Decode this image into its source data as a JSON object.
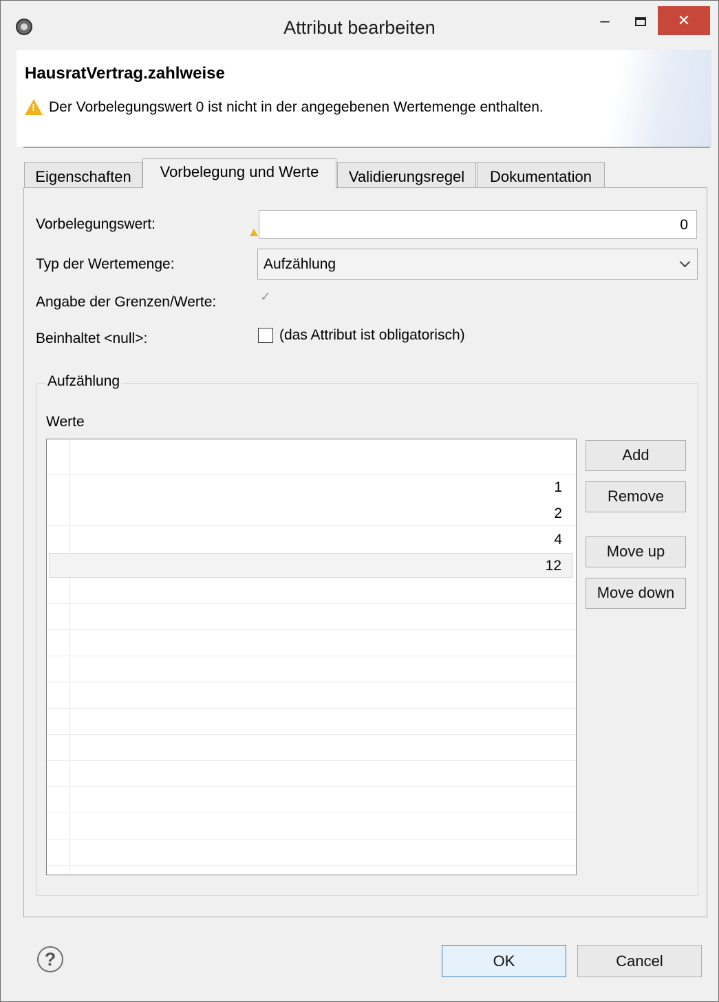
{
  "window": {
    "title": "Attribut bearbeiten",
    "min_glyph": "–",
    "close_glyph": "✕"
  },
  "header": {
    "title": "HausratVertrag.zahlweise",
    "message": "Der Vorbelegungswert 0 ist nicht in der angegebenen Wertemenge enthalten."
  },
  "tabs": [
    {
      "label": "Eigenschaften",
      "active": false
    },
    {
      "label": "Vorbelegung und Werte",
      "active": true
    },
    {
      "label": "Validierungsregel",
      "active": false
    },
    {
      "label": "Dokumentation",
      "active": false
    }
  ],
  "form": {
    "default_label": "Vorbelegungswert:",
    "default_value": "0",
    "type_label": "Typ der Wertemenge:",
    "type_value": "Aufzählung",
    "limits_label": "Angabe der Grenzen/Werte:",
    "limits_checked": true,
    "null_label": "Beinhaltet <null>:",
    "null_checked": false,
    "null_text": "(das Attribut ist obligatorisch)"
  },
  "group": {
    "legend": "Aufzählung",
    "values_label": "Werte",
    "values": [
      "1",
      "2",
      "4",
      "12"
    ]
  },
  "side_buttons": {
    "add": "Add",
    "remove": "Remove",
    "move_up": "Move up",
    "move_down": "Move down"
  },
  "footer": {
    "ok": "OK",
    "cancel": "Cancel",
    "help_glyph": "?"
  },
  "colors": {
    "close_button": "#c7473b",
    "warning": "#f2b21c",
    "ok_border": "#3c7fb1"
  }
}
